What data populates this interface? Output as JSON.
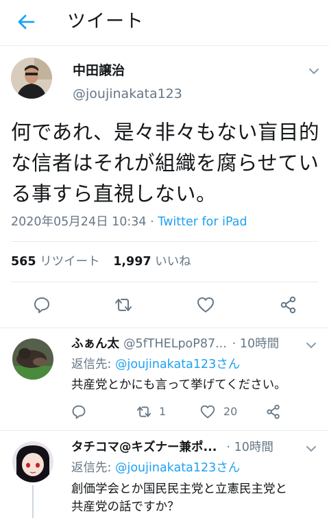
{
  "header": {
    "title": "ツイート"
  },
  "tweet": {
    "display_name": "中田譲治",
    "handle": "@joujinakata123",
    "text_lines": [
      "何であれ、是々非々もない盲目的",
      "な信者はそれが組織を腐らせてい",
      "る事すら直視しない。"
    ],
    "timestamp": "2020年05月24日 10:34",
    "separator": " · ",
    "source": "Twitter for iPad",
    "retweet_count": "565",
    "retweet_label": "リツイート",
    "like_count": "1,997",
    "like_label": "いいね"
  },
  "replies": [
    {
      "display_name": "ふぁん太",
      "handle": "@5fTHELpoP87...",
      "time": "· 10時間",
      "reply_to_label": "返信先:",
      "reply_to_handle": "@joujinakata123さん",
      "text": "共産党とかにも言って挙げてください。",
      "retweets": "1",
      "likes": "20"
    },
    {
      "display_name": "タチコマ@キズナー兼ポ...",
      "time": "· 10時間",
      "reply_to_label": "返信先:",
      "reply_to_handle": "@joujinakata123さん",
      "text_lines": [
        "創価学会とか国民民主党と立憲民主党と",
        "共産党の話ですか？"
      ]
    }
  ],
  "colors": {
    "accent": "#1da1f2",
    "muted": "#657786",
    "divider": "#e6ecf0"
  }
}
